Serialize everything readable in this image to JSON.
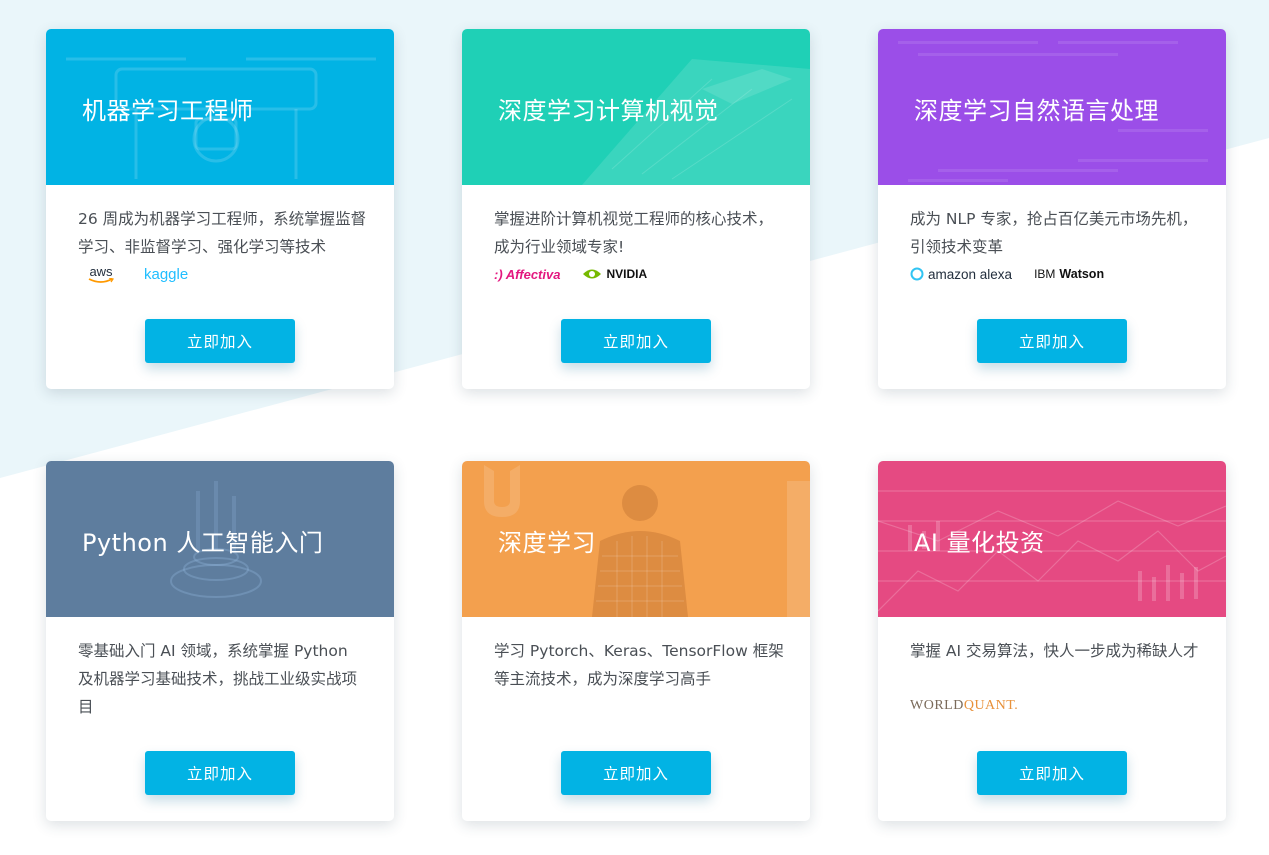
{
  "cards": [
    {
      "title": "机器学习工程师",
      "description": "26 周成为机器学习工程师，系统掌握监督学习、非监督学习、强化学习等技术",
      "partners": [
        "aws",
        "kaggle"
      ],
      "button": "立即加入",
      "color": "#02b3e4"
    },
    {
      "title": "深度学习计算机视觉",
      "description": "掌握进阶计算机视觉工程师的核心技术，成为行业领域专家!",
      "partners": [
        ":) Affectiva",
        "NVIDIA"
      ],
      "button": "立即加入",
      "color": "#1fd0b6"
    },
    {
      "title": "深度学习自然语言处理",
      "description": "成为 NLP 专家，抢占百亿美元市场先机，引领技术变革",
      "partners": [
        "amazon alexa",
        "IBM",
        "Watson"
      ],
      "button": "立即加入",
      "color": "#9b4ee8"
    },
    {
      "title": "Python 人工智能入门",
      "description": "零基础入门 AI 领域，系统掌握 Python 及机器学习基础技术，挑战工业级实战项目",
      "partners": [],
      "button": "立即加入",
      "color": "#5e7d9e"
    },
    {
      "title": "深度学习",
      "description": "学习 Pytorch、Keras、TensorFlow 框架等主流技术，成为深度学习高手",
      "partners": [],
      "button": "立即加入",
      "color": "#f3a04e"
    },
    {
      "title": "AI 量化投资",
      "description": "掌握 AI 交易算法，快人一步成为稀缺人才",
      "partners": [
        "WORLD",
        "QUANT."
      ],
      "button": "立即加入",
      "color": "#e54a82"
    }
  ],
  "accent_color": "#02b3e4"
}
